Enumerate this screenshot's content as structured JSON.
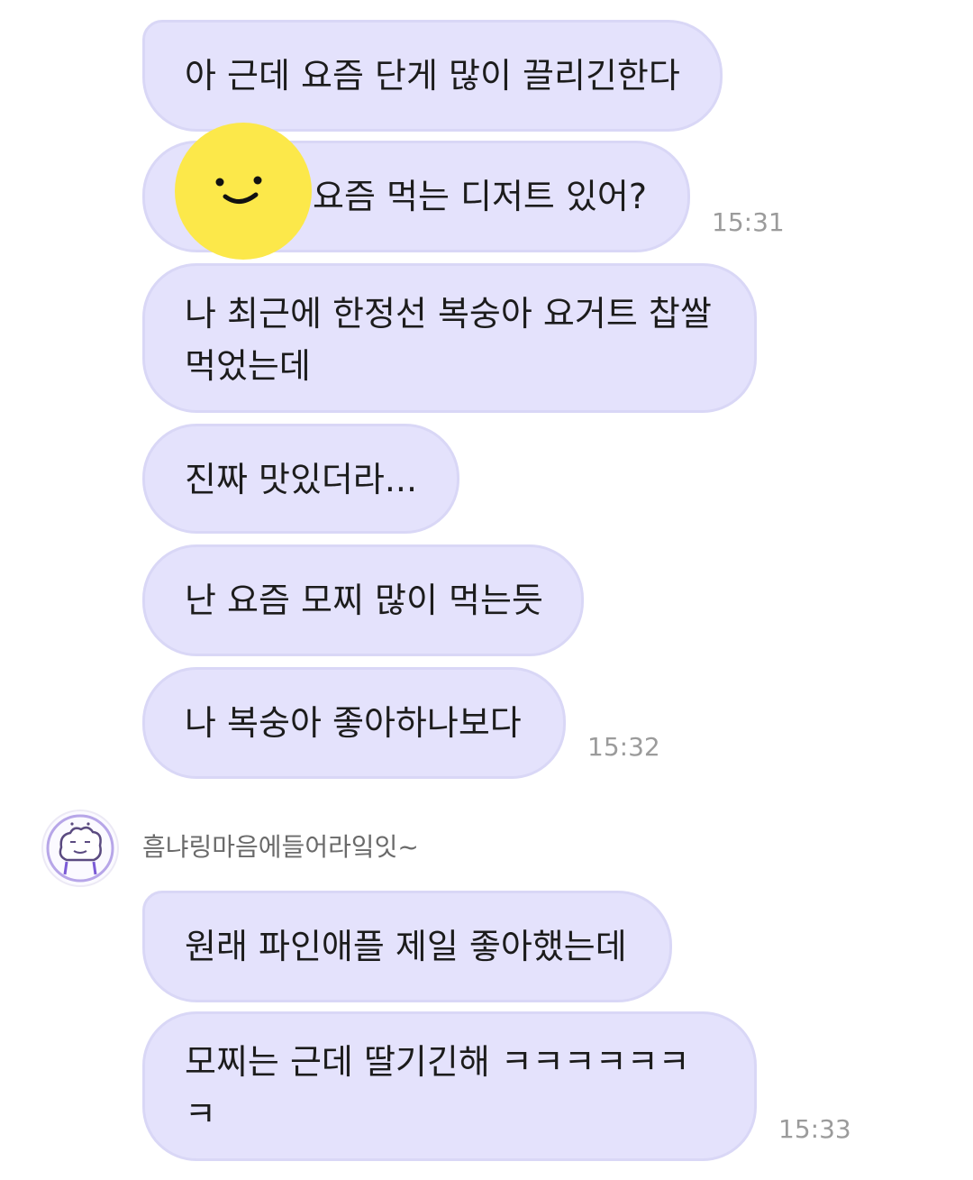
{
  "messages_sent": [
    {
      "text": "아 근데 요즘 단게 많이 끌리긴한다"
    },
    {
      "text": "요즘 먹는 디저트 있어?"
    },
    {
      "text": "나 최근에 한정선 복숭아 요거트 찹쌀 먹었는데"
    },
    {
      "text": "진짜 맛있더라..."
    },
    {
      "text": "난 요즘 모찌 많이 먹는듯"
    },
    {
      "text": "나 복숭아 좋아하나보다"
    }
  ],
  "times": {
    "first_group": "15:31",
    "second_group": "15:32",
    "reply_group": "15:33"
  },
  "reply": {
    "sender_name": "흠냐링마음에들어라잌잇~",
    "messages": [
      {
        "text": "원래 파인애플 제일 좋아했는데"
      },
      {
        "text": "모찌는 근데 딸기긴해 ㅋㅋㅋㅋㅋㅋㅋ"
      }
    ]
  },
  "colors": {
    "bubble": "#e4e2fc",
    "sticker": "#fce84a",
    "timestamp": "#9b9b9b"
  }
}
